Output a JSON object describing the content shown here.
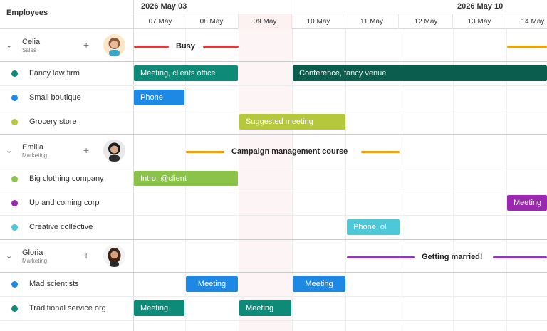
{
  "header": {
    "title": "Employees",
    "weeks": [
      "2026 May 03",
      "2026 May 10"
    ],
    "days": [
      "07 May",
      "08 May",
      "09 May",
      "10 May",
      "11 May",
      "12 May",
      "13 May",
      "14 May"
    ]
  },
  "colors": {
    "teal": "#0e8a78",
    "dark_green": "#0b5e4e",
    "blue": "#1e88e5",
    "lime": "#b5c73b",
    "green": "#8bc34a",
    "purple": "#9c27b0",
    "cyan": "#4dc8d8",
    "red": "#e53935",
    "orange": "#f39c12",
    "violet": "#8e3bb1"
  },
  "employees": [
    {
      "name": "Celia",
      "dept": "Sales",
      "event": "Busy",
      "resources": [
        "Fancy law firm",
        "Small boutique",
        "Grocery store"
      ]
    },
    {
      "name": "Emilia",
      "dept": "Marketing",
      "event": "Campaign management course",
      "resources": [
        "Big clothing company",
        "Up and coming corp",
        "Creative collective"
      ]
    },
    {
      "name": "Gloria",
      "dept": "Marketing",
      "event": "Getting married!",
      "resources": [
        "Mad scientists",
        "Traditional service org"
      ]
    }
  ],
  "events": {
    "meeting_clients": {
      "title": "Meeting",
      "sub": ", clients office"
    },
    "conference": {
      "title": "Conference",
      "sub": ", fancy venue"
    },
    "phone1": {
      "title": "Phone",
      "sub": ""
    },
    "suggested": {
      "title": "Suggested meeting",
      "sub": ""
    },
    "intro": {
      "title": "Intro",
      "sub": ", @client"
    },
    "meeting_up": {
      "title": "Meeting",
      "sub": ""
    },
    "phone2": {
      "title": "Phone",
      "sub": ", o!"
    },
    "meeting_mad1": {
      "title": "Meeting",
      "sub": ""
    },
    "meeting_mad2": {
      "title": "Meeting",
      "sub": ""
    },
    "meeting_trad1": {
      "title": "Meeting",
      "sub": ""
    },
    "meeting_trad2": {
      "title": "Meeting",
      "sub": ""
    }
  }
}
